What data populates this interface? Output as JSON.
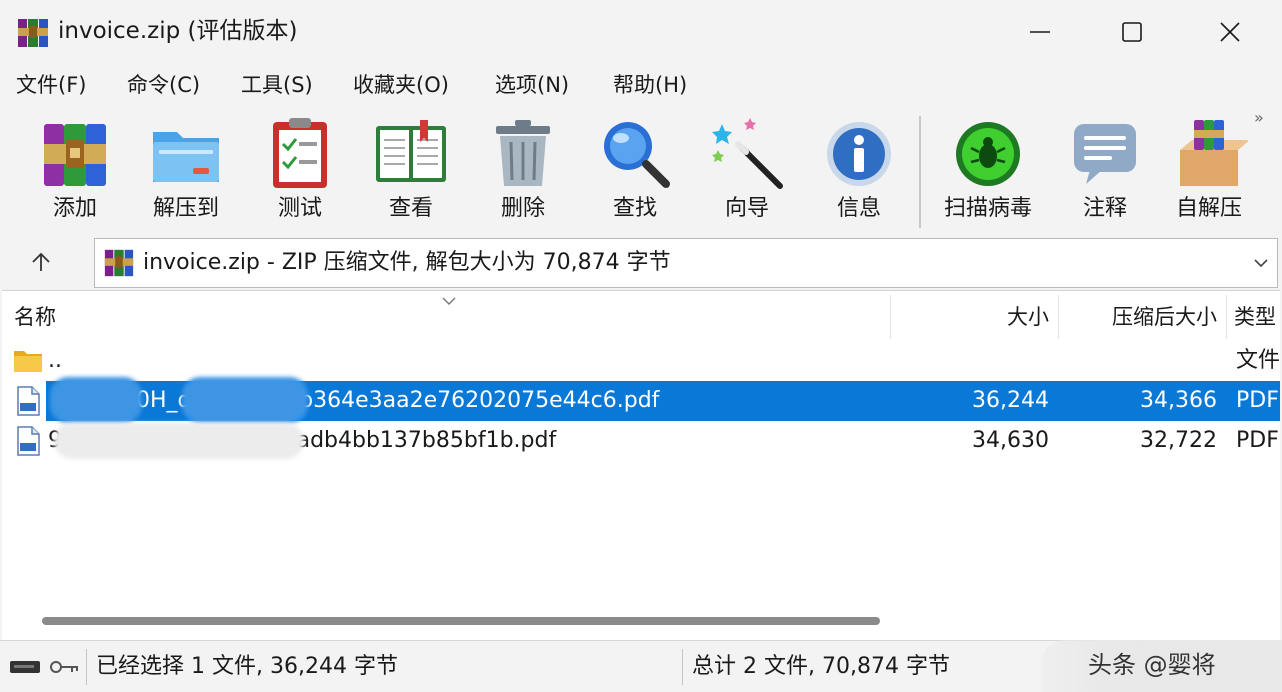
{
  "window": {
    "title": "invoice.zip (评估版本)"
  },
  "menu": [
    "文件(F)",
    "命令(C)",
    "工具(S)",
    "收藏夹(O)",
    "选项(N)",
    "帮助(H)"
  ],
  "toolbar": [
    {
      "label": "添加",
      "icon": "add-archive-icon"
    },
    {
      "label": "解压到",
      "icon": "extract-folder-icon"
    },
    {
      "label": "测试",
      "icon": "test-clipboard-icon"
    },
    {
      "label": "查看",
      "icon": "view-book-icon"
    },
    {
      "label": "删除",
      "icon": "trash-can-icon"
    },
    {
      "label": "查找",
      "icon": "magnifier-icon"
    },
    {
      "label": "向导",
      "icon": "wizard-wand-icon"
    },
    {
      "label": "信息",
      "icon": "info-icon"
    },
    {
      "label": "扫描病毒",
      "icon": "virus-scan-icon"
    },
    {
      "label": "注释",
      "icon": "comment-icon"
    },
    {
      "label": "自解压",
      "icon": "sfx-box-icon"
    }
  ],
  "toolbar_more": "»",
  "address": {
    "text": "invoice.zip - ZIP 压缩文件, 解包大小为 70,874 字节"
  },
  "columns": {
    "name": "名称",
    "size": "大小",
    "packed": "压缩后大小",
    "type": "类型"
  },
  "files": [
    {
      "name": "..",
      "size": "",
      "packed": "",
      "type": "文件",
      "selected": false
    },
    {
      "name": "00H_dc5c942edb364e3aa2e76202075e44c6.pdf",
      "size": "36,244",
      "packed": "34,366",
      "type": "PDF",
      "selected": true
    },
    {
      "name": "9A_af24b616fe84419cadb4bb137b85bf1b.pdf",
      "size": "34,630",
      "packed": "32,722",
      "type": "PDF",
      "selected": false
    }
  ],
  "status": {
    "left": "已经选择 1 文件, 36,244 字节",
    "right": "总计 2 文件, 70,874 字节"
  },
  "watermark": "头条 @婴将",
  "colors": {
    "selection": "#0a78d7",
    "window_bg": "#f3f3f3"
  }
}
